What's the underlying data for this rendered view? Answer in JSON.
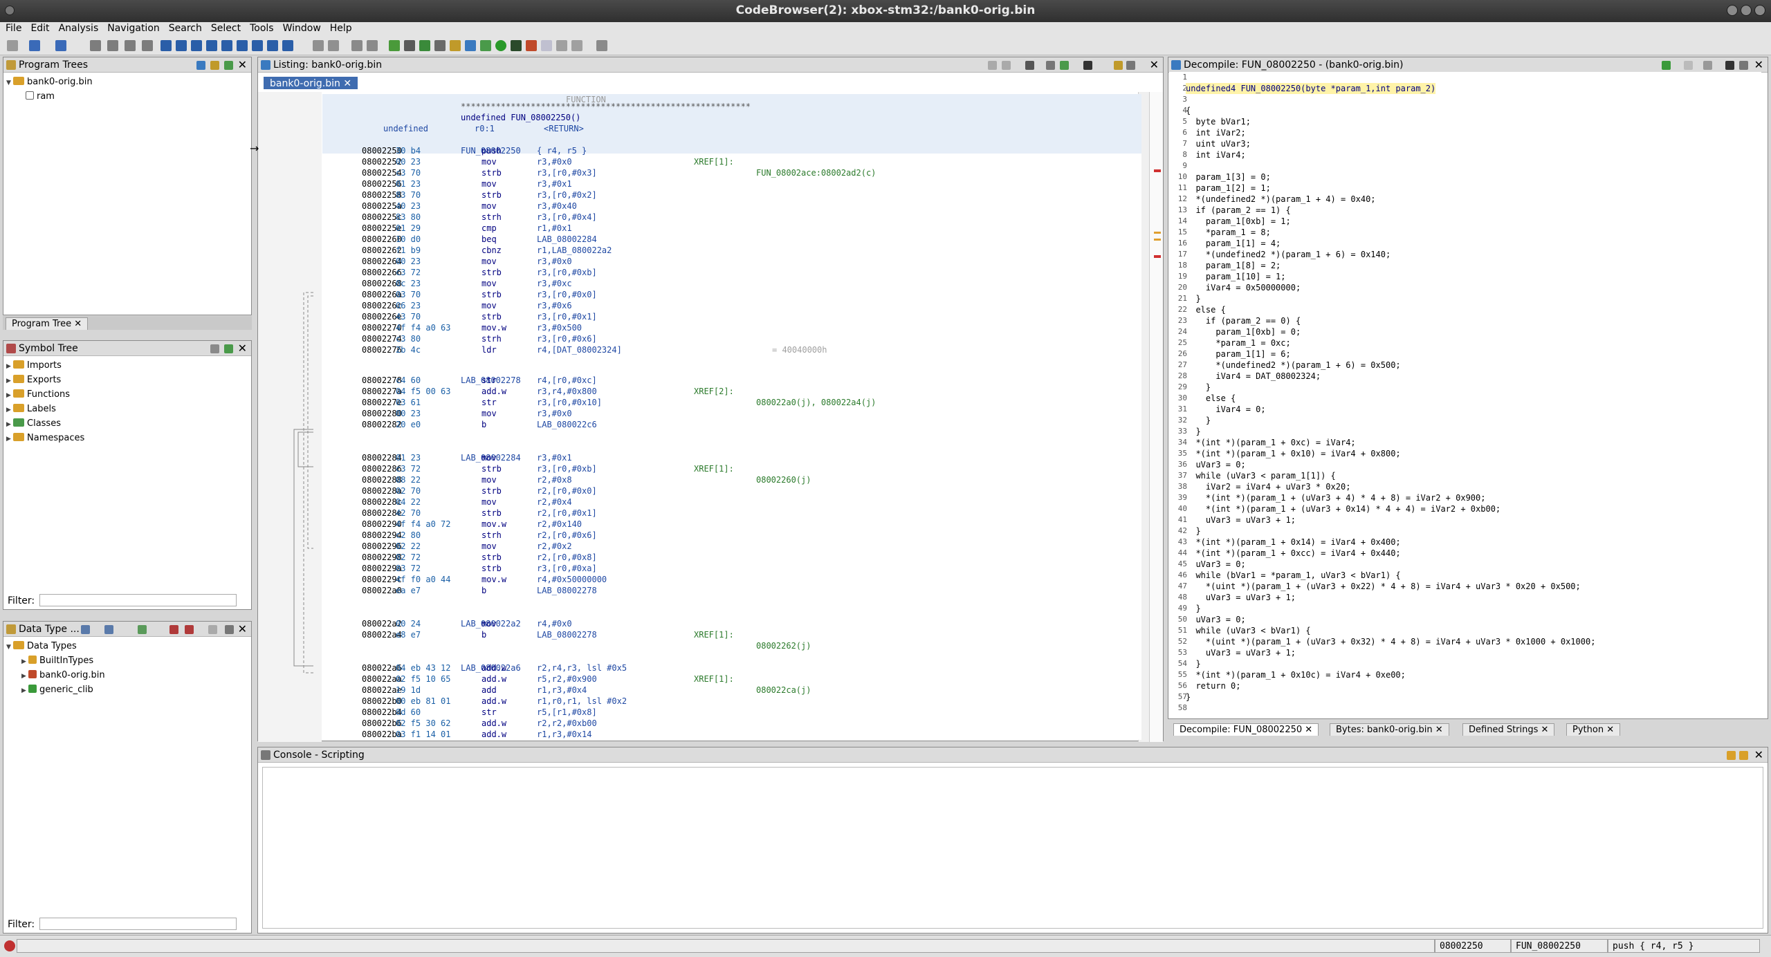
{
  "window_title": "CodeBrowser(2): xbox-stm32:/bank0-orig.bin",
  "menu": [
    "File",
    "Edit",
    "Analysis",
    "Navigation",
    "Search",
    "Select",
    "Tools",
    "Window",
    "Help"
  ],
  "program_trees": {
    "title": "Program Trees",
    "root": "bank0-orig.bin",
    "child": "ram",
    "tab": "Program Tree"
  },
  "symbol_tree": {
    "title": "Symbol Tree",
    "items": [
      "Imports",
      "Exports",
      "Functions",
      "Labels",
      "Classes",
      "Namespaces"
    ],
    "filter_label": "Filter:"
  },
  "data_types": {
    "title": "Data Type ...",
    "root": "Data Types",
    "items": [
      "BuiltInTypes",
      "bank0-orig.bin",
      "generic_clib"
    ],
    "filter_label": "Filter:"
  },
  "listing": {
    "title": "Listing:  bank0-orig.bin",
    "tab": "bank0-orig.bin",
    "header_func_label": "FUNCTION",
    "header_stars": "**********************************************************",
    "sig": "undefined FUN_08002250()",
    "ret_type": "undefined",
    "ret_reg": "r0:1",
    "ret_tag": "<RETURN>",
    "func_label": "FUN_08002250",
    "func_xref_label": "XREF[1]:",
    "func_xref_value": "FUN_08002ace:08002ad2(c)",
    "rows": [
      {
        "a": "08002250",
        "b": "30 b4",
        "m": "push",
        "o": "{ r4, r5 }"
      },
      {
        "a": "08002252",
        "b": "00 23",
        "m": "mov",
        "o": "r3,#0x0"
      },
      {
        "a": "08002254",
        "b": "c3 70",
        "m": "strb",
        "o": "r3,[r0,#0x3]"
      },
      {
        "a": "08002256",
        "b": "01 23",
        "m": "mov",
        "o": "r3,#0x1"
      },
      {
        "a": "08002258",
        "b": "83 70",
        "m": "strb",
        "o": "r3,[r0,#0x2]"
      },
      {
        "a": "0800225a",
        "b": "40 23",
        "m": "mov",
        "o": "r3,#0x40"
      },
      {
        "a": "0800225c",
        "b": "83 80",
        "m": "strh",
        "o": "r3,[r0,#0x4]"
      },
      {
        "a": "0800225e",
        "b": "01 29",
        "m": "cmp",
        "o": "r1,#0x1"
      },
      {
        "a": "08002260",
        "b": "10 d0",
        "m": "beq",
        "o": "LAB_08002284"
      },
      {
        "a": "08002262",
        "b": "f1 b9",
        "m": "cbnz",
        "o": "r1,LAB_080022a2"
      },
      {
        "a": "08002264",
        "b": "00 23",
        "m": "mov",
        "o": "r3,#0x0"
      },
      {
        "a": "08002266",
        "b": "c3 72",
        "m": "strb",
        "o": "r3,[r0,#0xb]"
      },
      {
        "a": "08002268",
        "b": "0c 23",
        "m": "mov",
        "o": "r3,#0xc"
      },
      {
        "a": "0800226a",
        "b": "03 70",
        "m": "strb",
        "o": "r3,[r0,#0x0]"
      },
      {
        "a": "0800226c",
        "b": "06 23",
        "m": "mov",
        "o": "r3,#0x6"
      },
      {
        "a": "0800226e",
        "b": "43 70",
        "m": "strb",
        "o": "r3,[r0,#0x1]"
      },
      {
        "a": "08002270",
        "b": "4f f4 a0 63",
        "m": "mov.w",
        "o": "r3,#0x500"
      },
      {
        "a": "08002274",
        "b": "c3 80",
        "m": "strh",
        "o": "r3,[r0,#0x6]"
      },
      {
        "a": "08002276",
        "b": "2b 4c",
        "m": "ldr",
        "o": "r4,[DAT_08002324]",
        "c": "= 40040000h"
      }
    ],
    "lab1": "LAB_08002278",
    "lab1_xref_label": "XREF[2]:",
    "lab1_xref": "080022a0(j), 080022a4(j)",
    "rows2": [
      {
        "a": "08002278",
        "b": "c4 60",
        "m": "str",
        "o": "r4,[r0,#0xc]"
      },
      {
        "a": "0800227a",
        "b": "04 f5 00 63",
        "m": "add.w",
        "o": "r3,r4,#0x800"
      },
      {
        "a": "0800227e",
        "b": "03 61",
        "m": "str",
        "o": "r3,[r0,#0x10]"
      },
      {
        "a": "08002280",
        "b": "00 23",
        "m": "mov",
        "o": "r3,#0x0"
      },
      {
        "a": "08002282",
        "b": "20 e0",
        "m": "b",
        "o": "LAB_080022c6"
      }
    ],
    "lab2": "LAB_08002284",
    "lab2_xref_label": "XREF[1]:",
    "lab2_xref": "08002260(j)",
    "rows3": [
      {
        "a": "08002284",
        "b": "01 23",
        "m": "mov",
        "o": "r3,#0x1"
      },
      {
        "a": "08002286",
        "b": "c3 72",
        "m": "strb",
        "o": "r3,[r0,#0xb]"
      },
      {
        "a": "08002288",
        "b": "08 22",
        "m": "mov",
        "o": "r2,#0x8"
      },
      {
        "a": "0800228a",
        "b": "02 70",
        "m": "strb",
        "o": "r2,[r0,#0x0]"
      },
      {
        "a": "0800228c",
        "b": "04 22",
        "m": "mov",
        "o": "r2,#0x4"
      },
      {
        "a": "0800228e",
        "b": "42 70",
        "m": "strb",
        "o": "r2,[r0,#0x1]"
      },
      {
        "a": "08002290",
        "b": "4f f4 a0 72",
        "m": "mov.w",
        "o": "r2,#0x140"
      },
      {
        "a": "08002294",
        "b": "c2 80",
        "m": "strh",
        "o": "r2,[r0,#0x6]"
      },
      {
        "a": "08002296",
        "b": "02 22",
        "m": "mov",
        "o": "r2,#0x2"
      },
      {
        "a": "08002298",
        "b": "02 72",
        "m": "strb",
        "o": "r2,[r0,#0x8]"
      },
      {
        "a": "0800229a",
        "b": "83 72",
        "m": "strb",
        "o": "r3,[r0,#0xa]"
      },
      {
        "a": "0800229c",
        "b": "4f f0 a0 44",
        "m": "mov.w",
        "o": "r4,#0x50000000"
      },
      {
        "a": "080022a0",
        "b": "ea e7",
        "m": "b",
        "o": "LAB_08002278"
      }
    ],
    "lab3": "LAB_080022a2",
    "lab3_xref_label": "XREF[1]:",
    "lab3_xref": "08002262(j)",
    "rows4": [
      {
        "a": "080022a2",
        "b": "00 24",
        "m": "mov",
        "o": "r4,#0x0"
      },
      {
        "a": "080022a4",
        "b": "e8 e7",
        "m": "b",
        "o": "LAB_08002278"
      }
    ],
    "lab4": "LAB_080022a6",
    "lab4_xref_label": "XREF[1]:",
    "lab4_xref": "080022ca(j)",
    "rows5": [
      {
        "a": "080022a6",
        "b": "04 eb 43 12",
        "m": "add.w",
        "o": "r2,r4,r3, lsl #0x5"
      },
      {
        "a": "080022aa",
        "b": "02 f5 10 65",
        "m": "add.w",
        "o": "r5,r2,#0x900"
      },
      {
        "a": "080022ae",
        "b": "19 1d",
        "m": "add",
        "o": "r1,r3,#0x4"
      },
      {
        "a": "080022b0",
        "b": "00 eb 81 01",
        "m": "add.w",
        "o": "r1,r0,r1, lsl #0x2"
      },
      {
        "a": "080022b4",
        "b": "8d 60",
        "m": "str",
        "o": "r5,[r1,#0x8]"
      },
      {
        "a": "080022b6",
        "b": "02 f5 30 62",
        "m": "add.w",
        "o": "r2,r2,#0xb00"
      },
      {
        "a": "080022ba",
        "b": "03 f1 14 01",
        "m": "add.w",
        "o": "r1,r3,#0x14"
      }
    ]
  },
  "decompiler": {
    "title": "Decompile: FUN_08002250 -  (bank0-orig.bin)",
    "lines": [
      "",
      "undefined4 FUN_08002250(byte *param_1,int param_2)",
      "",
      "{",
      "  byte bVar1;",
      "  int iVar2;",
      "  uint uVar3;",
      "  int iVar4;",
      "",
      "  param_1[3] = 0;",
      "  param_1[2] = 1;",
      "  *(undefined2 *)(param_1 + 4) = 0x40;",
      "  if (param_2 == 1) {",
      "    param_1[0xb] = 1;",
      "    *param_1 = 8;",
      "    param_1[1] = 4;",
      "    *(undefined2 *)(param_1 + 6) = 0x140;",
      "    param_1[8] = 2;",
      "    param_1[10] = 1;",
      "    iVar4 = 0x50000000;",
      "  }",
      "  else {",
      "    if (param_2 == 0) {",
      "      param_1[0xb] = 0;",
      "      *param_1 = 0xc;",
      "      param_1[1] = 6;",
      "      *(undefined2 *)(param_1 + 6) = 0x500;",
      "      iVar4 = DAT_08002324;",
      "    }",
      "    else {",
      "      iVar4 = 0;",
      "    }",
      "  }",
      "  *(int *)(param_1 + 0xc) = iVar4;",
      "  *(int *)(param_1 + 0x10) = iVar4 + 0x800;",
      "  uVar3 = 0;",
      "  while (uVar3 < param_1[1]) {",
      "    iVar2 = iVar4 + uVar3 * 0x20;",
      "    *(int *)(param_1 + (uVar3 + 4) * 4 + 8) = iVar2 + 0x900;",
      "    *(int *)(param_1 + (uVar3 + 0x14) * 4 + 4) = iVar2 + 0xb00;",
      "    uVar3 = uVar3 + 1;",
      "  }",
      "  *(int *)(param_1 + 0x14) = iVar4 + 0x400;",
      "  *(int *)(param_1 + 0xcc) = iVar4 + 0x440;",
      "  uVar3 = 0;",
      "  while (bVar1 = *param_1, uVar3 < bVar1) {",
      "    *(uint *)(param_1 + (uVar3 + 0x22) * 4 + 8) = iVar4 + uVar3 * 0x20 + 0x500;",
      "    uVar3 = uVar3 + 1;",
      "  }",
      "  uVar3 = 0;",
      "  while (uVar3 < bVar1) {",
      "    *(uint *)(param_1 + (uVar3 + 0x32) * 4 + 8) = iVar4 + uVar3 * 0x1000 + 0x1000;",
      "    uVar3 = uVar3 + 1;",
      "  }",
      "  *(int *)(param_1 + 0x10c) = iVar4 + 0xe00;",
      "  return 0;",
      "}",
      ""
    ],
    "tabs": [
      "Decompile: FUN_08002250",
      "Bytes: bank0-orig.bin",
      "Defined Strings",
      "Python"
    ]
  },
  "console": {
    "title": "Console - Scripting"
  },
  "status": {
    "address": "08002250",
    "function": "FUN_08002250",
    "instruction": "push { r4, r5 }"
  }
}
